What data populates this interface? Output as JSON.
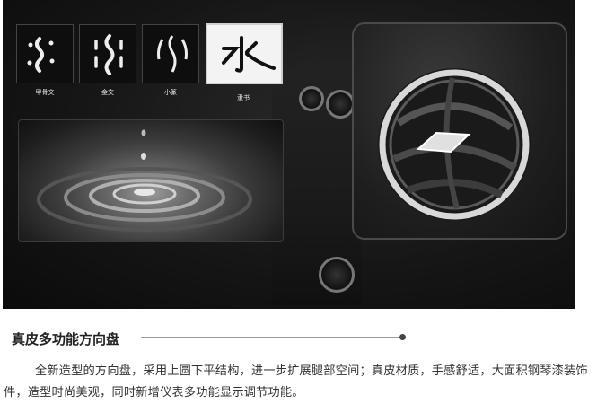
{
  "scripts": [
    {
      "label": "甲骨文",
      "glyph": "oracle-bone-water"
    },
    {
      "label": "金文",
      "glyph": "bronze-water"
    },
    {
      "label": "小篆",
      "glyph": "seal-water"
    },
    {
      "label": "隶书",
      "glyph": "clerical-water",
      "selected": true
    }
  ],
  "section": {
    "title": "真皮多功能方向盘",
    "body": "全新造型的方向盘，采用上圆下平结构，进一步扩展腿部空间；真皮材质，手感舒适，大面积钢琴漆装饰件，造型时尚美观，同时新增仪表多功能显示调节功能。"
  }
}
